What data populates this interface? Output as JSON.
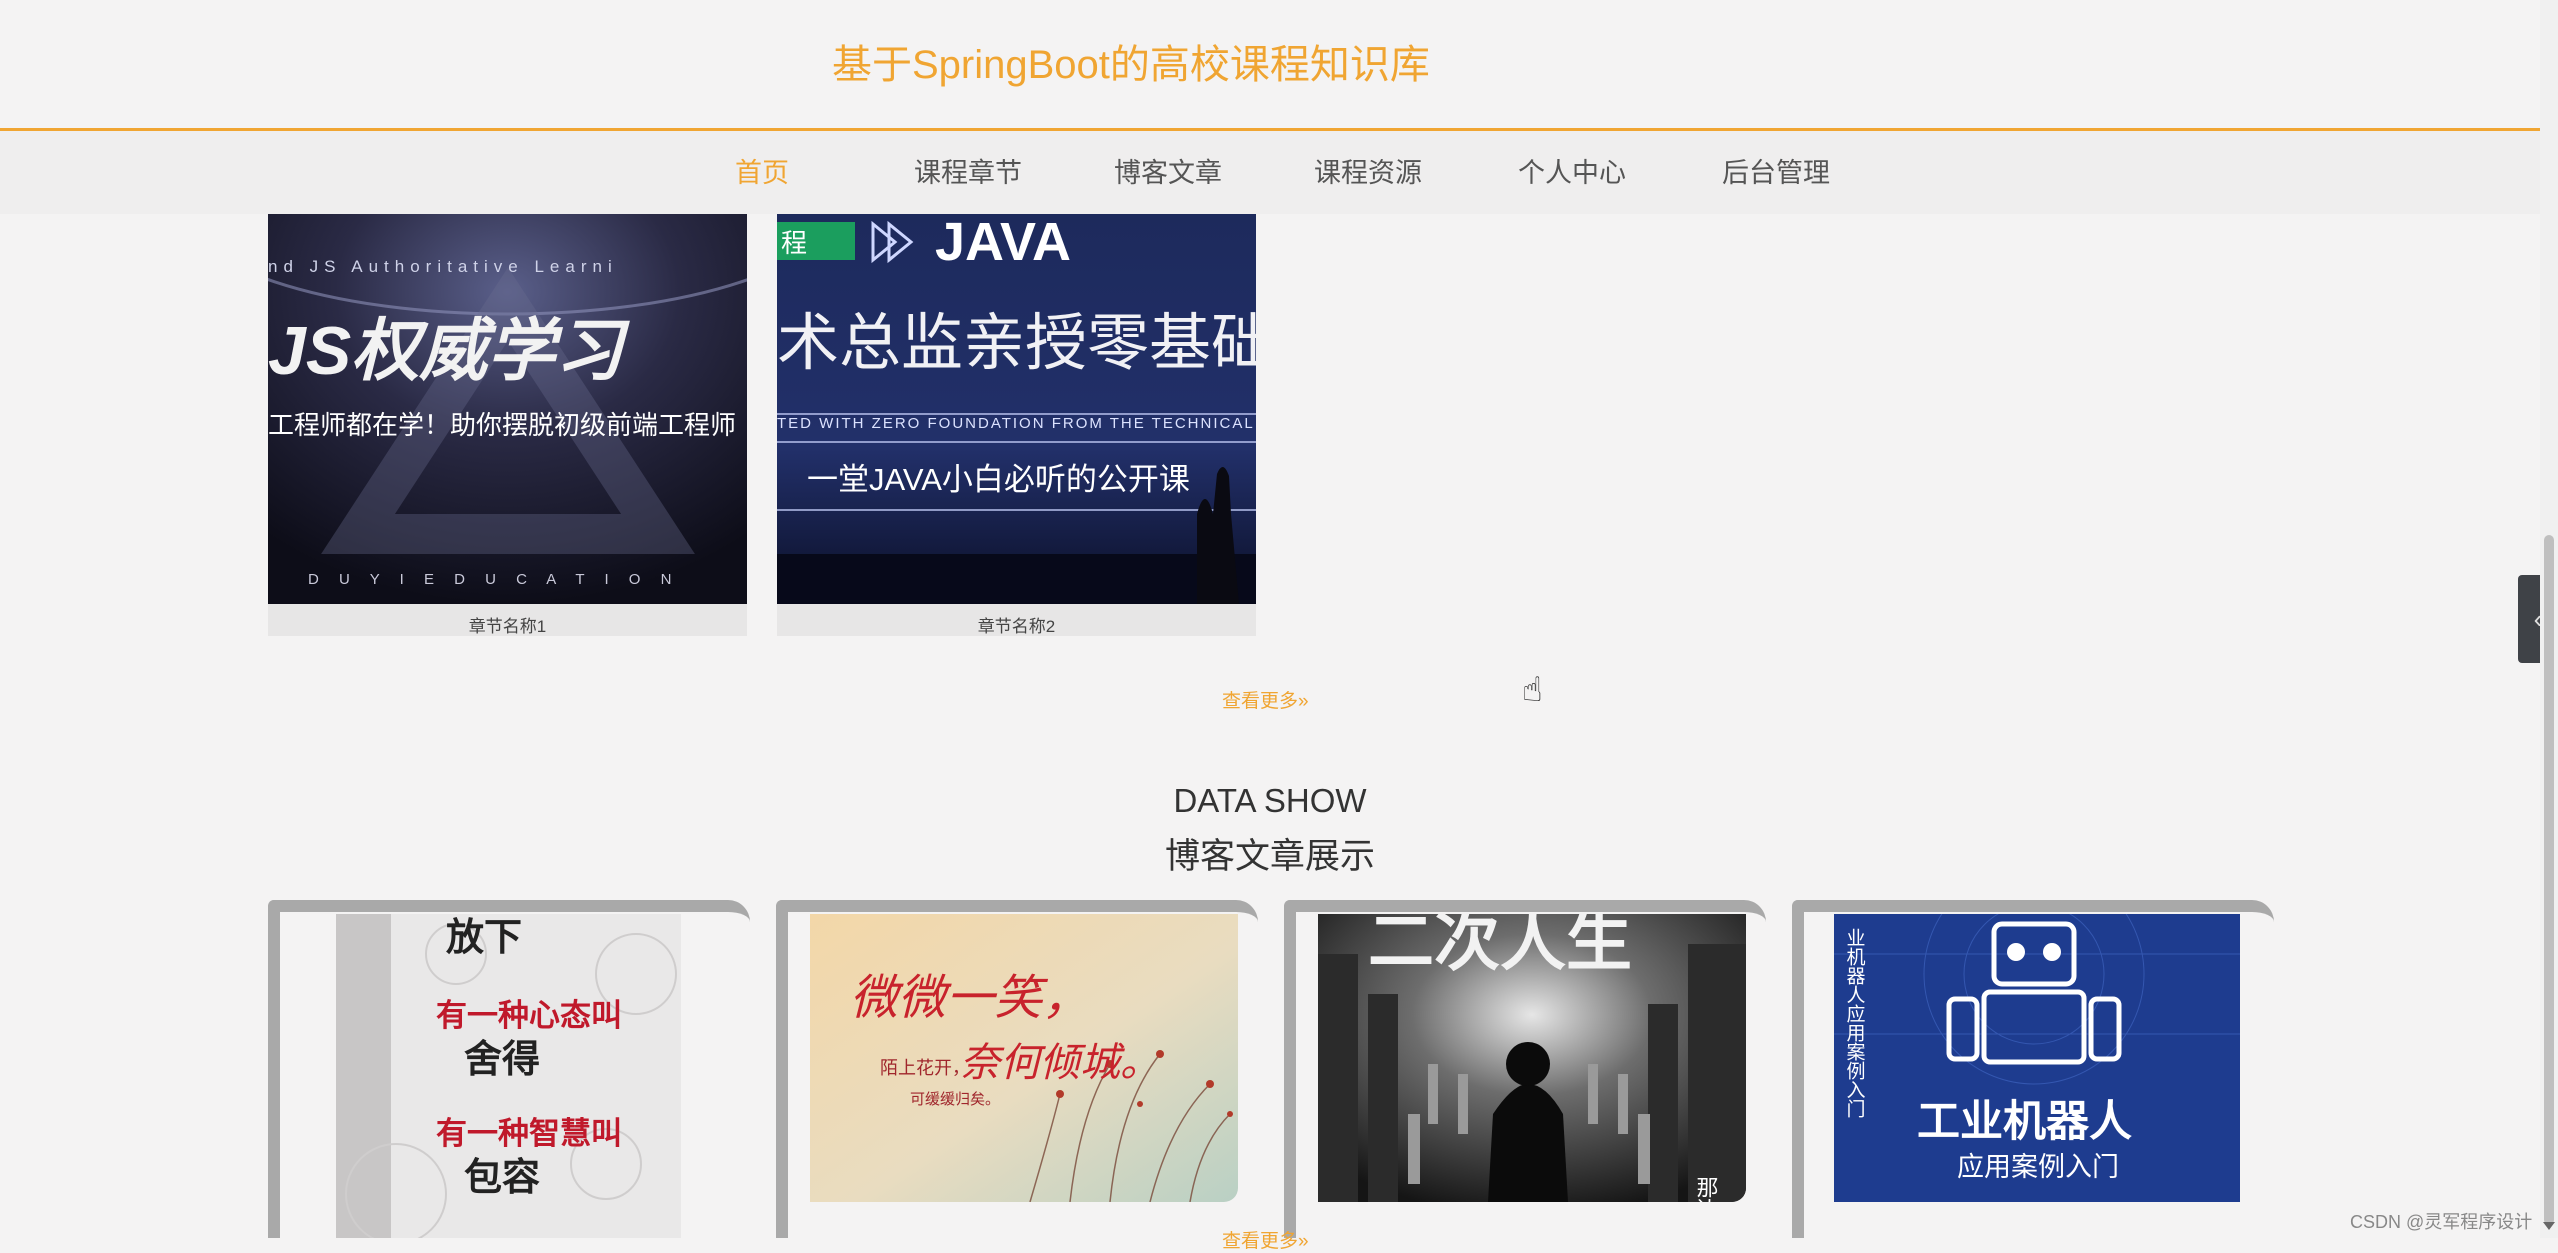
{
  "header": {
    "site_title": "基于SpringBoot的高校课程知识库"
  },
  "nav": {
    "items": [
      {
        "label": "首页",
        "active": true
      },
      {
        "label": "课程章节",
        "active": false
      },
      {
        "label": "博客文章",
        "active": false
      },
      {
        "label": "课程资源",
        "active": false
      },
      {
        "label": "个人中心",
        "active": false
      },
      {
        "label": "后台管理",
        "active": false
      }
    ]
  },
  "chapters": {
    "items": [
      {
        "label": "章节名称1",
        "cover": {
          "top_line": "nd JS Authoritative Learni",
          "headline": "JS权威学习",
          "subline": "工程师都在学！助你摆脱初级前端工程师",
          "bottom_line": "D U Y I   E D U C A T I O N"
        }
      },
      {
        "label": "章节名称2",
        "cover": {
          "badge": "程",
          "logo": "JAVA",
          "headline": "术总监亲授零基础",
          "subline_en": "TED WITH ZERO FOUNDATION FROM THE TECHNICAL D",
          "subline": "一堂JAVA小白必听的公开课"
        }
      }
    ],
    "more_label": "查看更多»"
  },
  "blog_section": {
    "title_en": "DATA SHOW",
    "title_cn": "博客文章展示",
    "items": [
      {
        "cover_lines": [
          "放下",
          "有一种心态叫",
          "舍得",
          "有一种智慧叫",
          "包容"
        ]
      },
      {
        "cover_lines": [
          "微微一笑，",
          "陌上花开，",
          "奈何倾城。",
          "可缓缓归矣。"
        ]
      },
      {
        "cover_lines": [
          "二次人生",
          "那边没"
        ]
      },
      {
        "cover_lines": [
          "工业机器人",
          "应用案例入门",
          "业机器人应用案例入门"
        ]
      }
    ],
    "more_label": "查看更多»"
  },
  "side_tab": {
    "icon": "chevron-left-icon",
    "glyph": "‹"
  },
  "watermark": "CSDN @灵军程序设计",
  "colors": {
    "accent": "#f0a532",
    "background": "#f4f3f3",
    "nav_text": "#555555"
  }
}
